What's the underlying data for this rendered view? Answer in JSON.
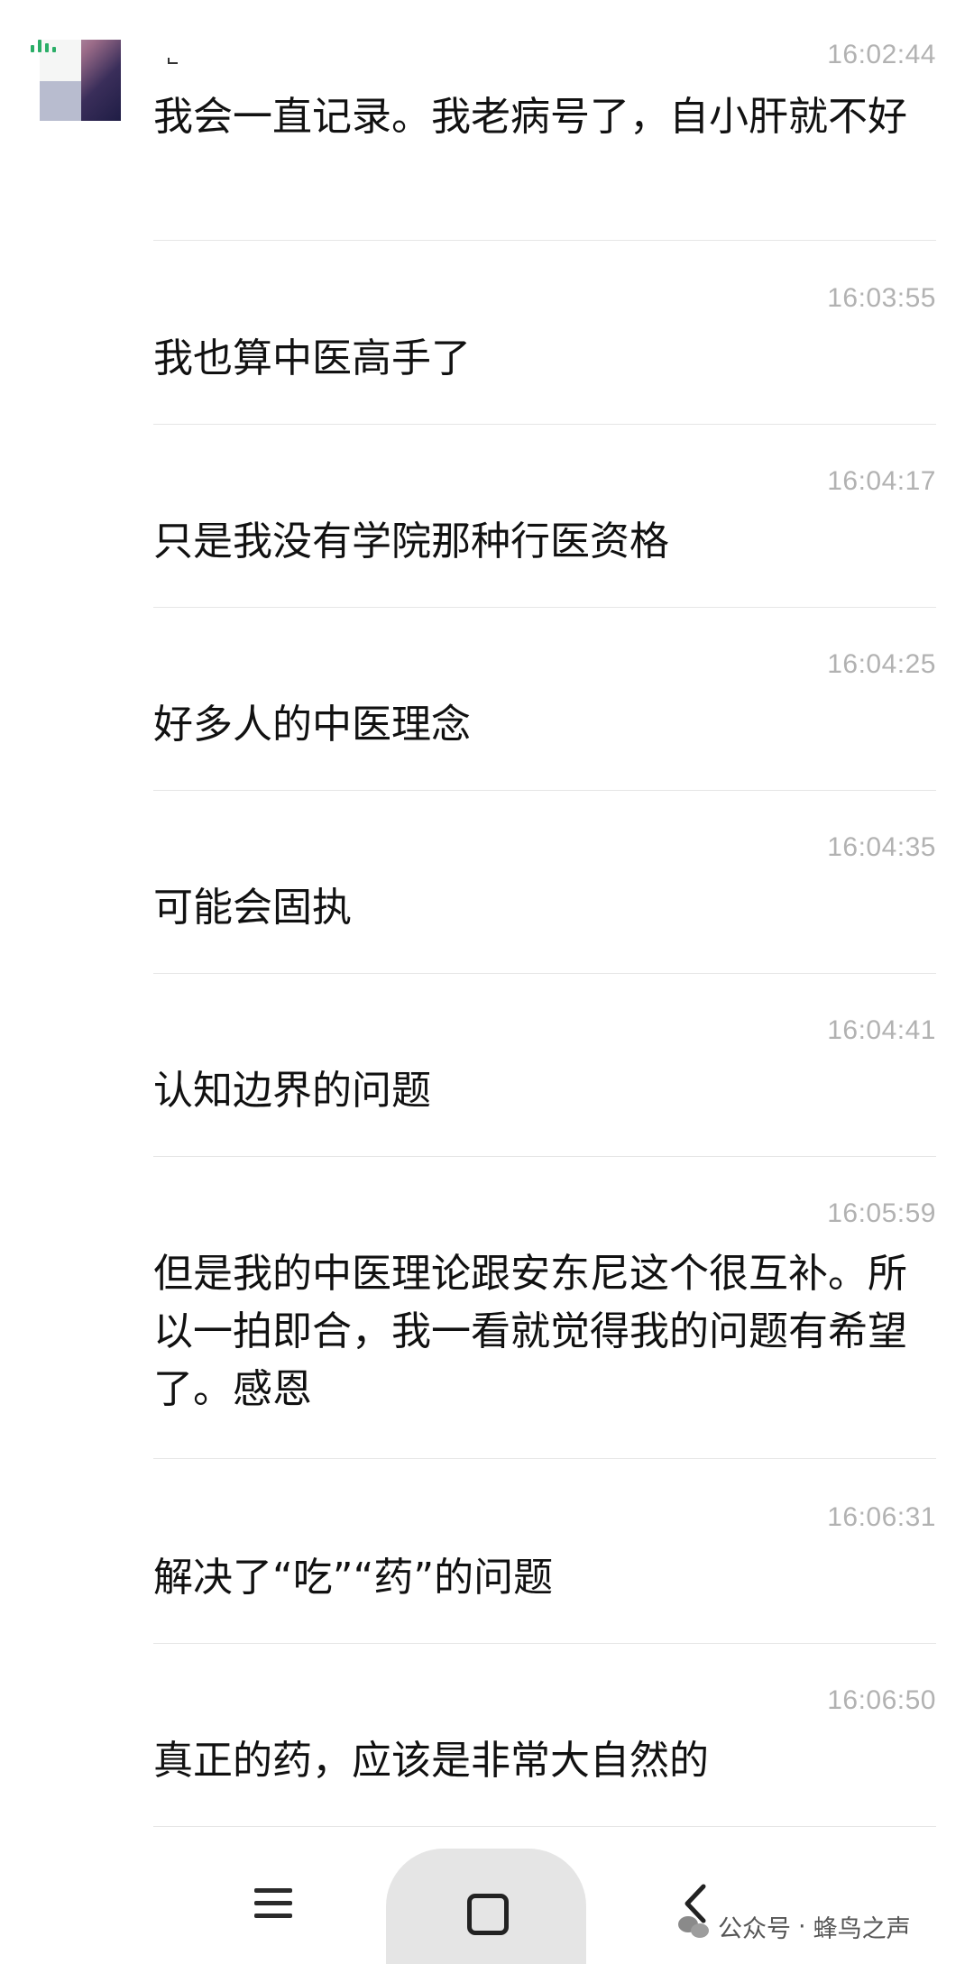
{
  "messages": [
    {
      "time": "16:02:44",
      "text": "我会一直记录。我老病号了，自小肝就不好"
    },
    {
      "time": "16:03:55",
      "text": "我也算中医高手了"
    },
    {
      "time": "16:04:17",
      "text": "只是我没有学院那种行医资格"
    },
    {
      "time": "16:04:25",
      "text": "好多人的中医理念"
    },
    {
      "time": "16:04:35",
      "text": "可能会固执"
    },
    {
      "time": "16:04:41",
      "text": "认知边界的问题"
    },
    {
      "time": "16:05:59",
      "text": "但是我的中医理论跟安东尼这个很互补。所以一拍即合，我一看就觉得我的问题有希望了。感恩"
    },
    {
      "time": "16:06:31",
      "text": "解决了“吃”“药”的问题"
    },
    {
      "time": "16:06:50",
      "text": "真正的药，应该是非常大自然的"
    }
  ],
  "watermark": {
    "account_label": "公众号",
    "separator": "·",
    "account_name": "蜂鸟之声"
  },
  "icons": {
    "menu": "menu-icon",
    "home": "home-icon",
    "back": "back-icon",
    "signal": "signal-icon",
    "wechat": "wechat-icon"
  }
}
